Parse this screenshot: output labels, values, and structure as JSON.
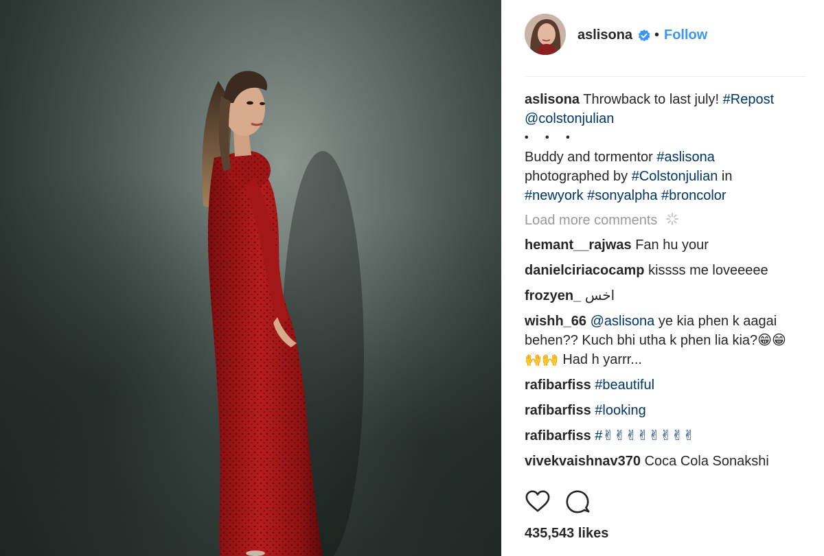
{
  "header": {
    "username": "aslisona",
    "separator": "•",
    "follow_label": "Follow",
    "verified_color": "#3897f0",
    "avatar_icon": "profile-photo"
  },
  "caption": {
    "username": "aslisona",
    "text": "Throwback to last july!",
    "hashtag": "#Repost",
    "mention": "@colstonjulian",
    "ellipsis": "• • •",
    "line2_text": "Buddy and tormentor",
    "line2_tag": "#aslisona",
    "line3_text": "photographed by",
    "line3_tag": "#Colstonjulian",
    "line3_after": "in",
    "tags_line": [
      "#newyork",
      "#sonyalpha",
      "#broncolor"
    ]
  },
  "load_more": "Load more comments",
  "comments": [
    {
      "user": "hemant__rajwas",
      "text": "Fan hu your"
    },
    {
      "user": "danielciriacocamp",
      "text": "kissss me loveeeee"
    },
    {
      "user": "frozyen_",
      "text": "اخس"
    },
    {
      "user": "wishh_66",
      "mention": "@aslisona",
      "text": "ye kia phen k aagai behen?? Kuch bhi utha k phen lia kia?😁😁🙌🙌 Had h yarrr..."
    },
    {
      "user": "rafibarfiss",
      "tag": "#beautiful"
    },
    {
      "user": "rafibarfiss",
      "tag": "#looking"
    },
    {
      "user": "rafibarfiss",
      "tag": "#",
      "text": "✌✌✌✌✌✌✌✌"
    },
    {
      "user": "vivekvaishnav370",
      "text": "Coca Cola Sonakshi"
    }
  ],
  "actions": {
    "like_icon": "heart-icon",
    "comment_icon": "comment-bubble-icon"
  },
  "likes": "435,543 likes",
  "colors": {
    "link": "#003569",
    "follow": "#3897f0",
    "muted": "#999999",
    "text": "#262626"
  }
}
